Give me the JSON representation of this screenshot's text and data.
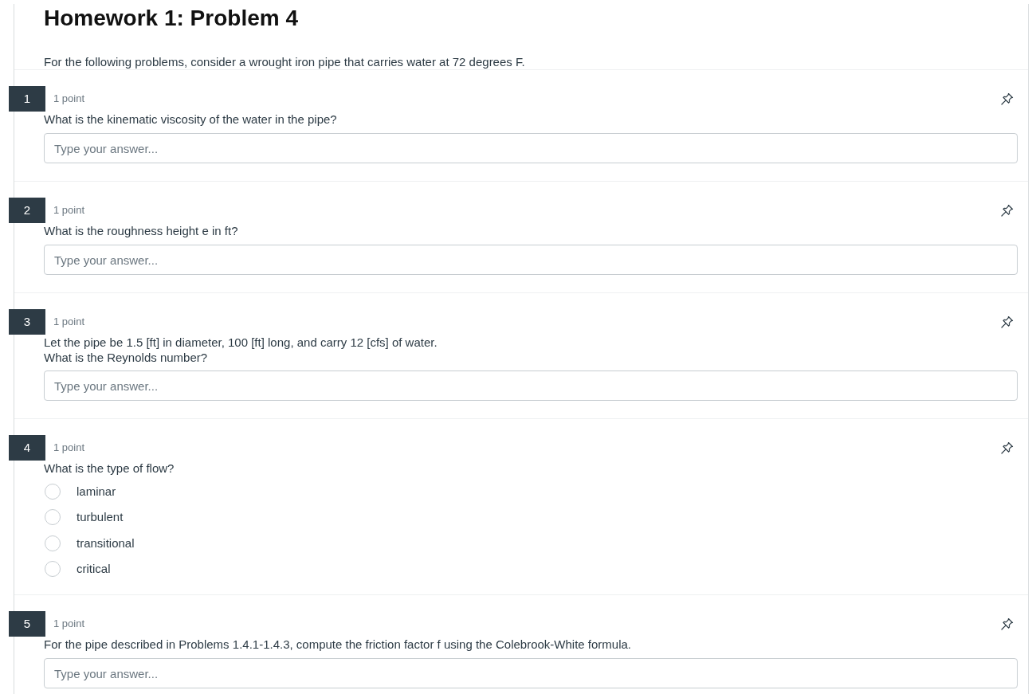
{
  "page": {
    "title": "Homework 1: Problem 4",
    "description": "For the following problems, consider a wrought iron pipe that carries water at 72 degrees F."
  },
  "questions": [
    {
      "number": "1",
      "points": "1 point",
      "kind": "text",
      "prompt": [
        "What is the kinematic viscosity of the water in the pipe?"
      ],
      "answer": {
        "placeholder": "Type your answer..."
      }
    },
    {
      "number": "2",
      "points": "1 point",
      "kind": "text",
      "prompt": [
        "What is the roughness height e in ft?"
      ],
      "answer": {
        "placeholder": "Type your answer..."
      }
    },
    {
      "number": "3",
      "points": "1 point",
      "kind": "text",
      "prompt": [
        "Let the pipe be 1.5 [ft] in diameter, 100 [ft] long, and carry 12 [cfs] of water.",
        "What is the Reynolds number?"
      ],
      "answer": {
        "placeholder": "Type your answer..."
      }
    },
    {
      "number": "4",
      "points": "1 point",
      "kind": "choice",
      "prompt": [
        "What is the type of flow?"
      ],
      "options": [
        {
          "label": "laminar",
          "selected": false
        },
        {
          "label": "turbulent",
          "selected": false
        },
        {
          "label": "transitional",
          "selected": false
        },
        {
          "label": "critical",
          "selected": false
        }
      ]
    },
    {
      "number": "5",
      "points": "1 point",
      "kind": "text",
      "prompt": [
        "For the pipe described in Problems 1.4.1-1.4.3, compute the friction factor f using the Colebrook-White formula."
      ],
      "answer": {
        "placeholder": "Type your answer..."
      }
    }
  ]
}
